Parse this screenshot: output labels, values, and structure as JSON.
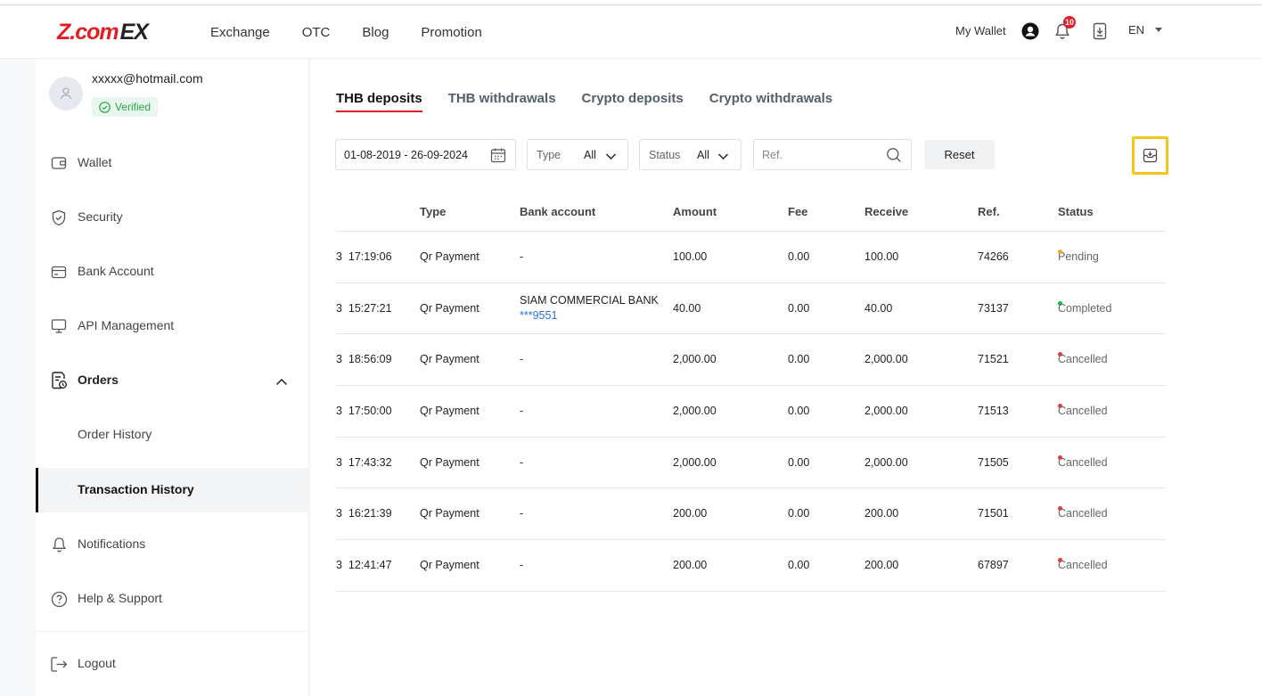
{
  "header": {
    "logo_main": "Z.com",
    "logo_ex": "EX",
    "nav": [
      "Exchange",
      "OTC",
      "Blog",
      "Promotion"
    ],
    "my_wallet": "My Wallet",
    "notification_count": "10",
    "language": "EN"
  },
  "sidebar": {
    "email": "xxxxx@hotmail.com",
    "verified": "Verified",
    "items": {
      "wallet": "Wallet",
      "security": "Security",
      "bank_account": "Bank Account",
      "api": "API Management",
      "orders": "Orders",
      "order_history": "Order History",
      "transaction_history": "Transaction History",
      "notifications": "Notifications",
      "help": "Help & Support",
      "logout": "Logout"
    }
  },
  "tabs": [
    "THB deposits",
    "THB withdrawals",
    "Crypto deposits",
    "Crypto withdrawals"
  ],
  "filters": {
    "date_range": "01-08-2019 - 26-09-2024",
    "type_label": "Type",
    "type_value": "All",
    "status_label": "Status",
    "status_value": "All",
    "ref_placeholder": "Ref.",
    "reset_label": "Reset"
  },
  "table": {
    "headers": [
      "Type",
      "Bank account",
      "Amount",
      "Fee",
      "Receive",
      "Ref.",
      "Status"
    ],
    "rows": [
      {
        "time": "3  17:19:06",
        "type": "Qr Payment",
        "bank": "-",
        "bank_acct": "",
        "amount": "100.00",
        "fee": "0.00",
        "receive": "100.00",
        "ref": "74266",
        "status": "Pending",
        "status_color": "#f5a623"
      },
      {
        "time": "3  15:27:21",
        "type": "Qr Payment",
        "bank": "SIAM COMMERCIAL BANK",
        "bank_acct": "***9551",
        "amount": "40.00",
        "fee": "0.00",
        "receive": "40.00",
        "ref": "73137",
        "status": "Completed",
        "status_color": "#1fae55"
      },
      {
        "time": "3  18:56:09",
        "type": "Qr Payment",
        "bank": "-",
        "bank_acct": "",
        "amount": "2,000.00",
        "fee": "0.00",
        "receive": "2,000.00",
        "ref": "71521",
        "status": "Cancelled",
        "status_color": "#e53945"
      },
      {
        "time": "3  17:50:00",
        "type": "Qr Payment",
        "bank": "-",
        "bank_acct": "",
        "amount": "2,000.00",
        "fee": "0.00",
        "receive": "2,000.00",
        "ref": "71513",
        "status": "Cancelled",
        "status_color": "#e53945"
      },
      {
        "time": "3  17:43:32",
        "type": "Qr Payment",
        "bank": "-",
        "bank_acct": "",
        "amount": "2,000.00",
        "fee": "0.00",
        "receive": "2,000.00",
        "ref": "71505",
        "status": "Cancelled",
        "status_color": "#e53945"
      },
      {
        "time": "3  16:21:39",
        "type": "Qr Payment",
        "bank": "-",
        "bank_acct": "",
        "amount": "200.00",
        "fee": "0.00",
        "receive": "200.00",
        "ref": "71501",
        "status": "Cancelled",
        "status_color": "#e53945"
      },
      {
        "time": "3  12:41:47",
        "type": "Qr Payment",
        "bank": "-",
        "bank_acct": "",
        "amount": "200.00",
        "fee": "0.00",
        "receive": "200.00",
        "ref": "67897",
        "status": "Cancelled",
        "status_color": "#e53945"
      }
    ]
  }
}
